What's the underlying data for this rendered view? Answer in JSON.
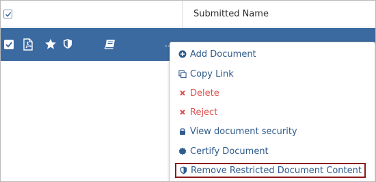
{
  "header": {
    "column_label": "Submitted Name"
  },
  "row": {
    "hidden_text": "· · · · · · ·"
  },
  "menu": {
    "items": [
      {
        "label": "Add Document",
        "icon": "plus-circle-icon"
      },
      {
        "label": "Copy Link",
        "icon": "copy-icon"
      },
      {
        "label": "Delete",
        "icon": "x-icon"
      },
      {
        "label": "Reject",
        "icon": "x-icon"
      },
      {
        "label": "View document security",
        "icon": "lock-icon"
      },
      {
        "label": "Certify Document",
        "icon": "certificate-icon"
      },
      {
        "label": "Remove Restricted Document Content",
        "icon": "shield-icon"
      }
    ]
  },
  "colors": {
    "row_selected": "#3b6aa0",
    "menu_link": "#2f5b8d",
    "menu_danger": "#d9534f",
    "highlight_border": "#8b1a1a"
  }
}
